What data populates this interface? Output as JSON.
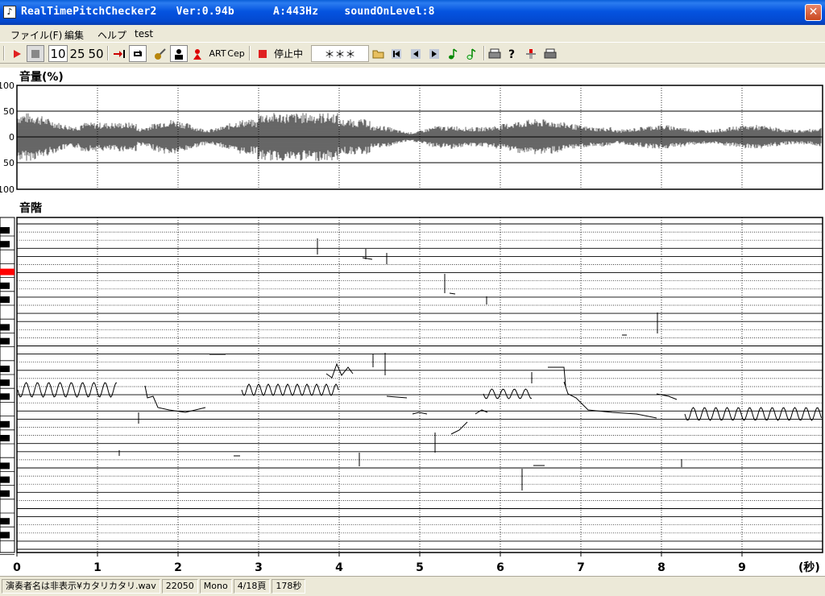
{
  "window": {
    "title": "RealTimePitchChecker2   Ver:0.94b      A:443Hz    soundOnLevel:8",
    "app_icon": "tuning-fork-icon",
    "close_label": "✕"
  },
  "menu": [
    {
      "label": "ファイル(F)"
    },
    {
      "label": "編集"
    },
    {
      "label": "ヘルプ"
    },
    {
      "label": "test"
    }
  ],
  "toolbar": {
    "play_icon": "play-icon",
    "stop_icon": "stop-icon",
    "zoom_10": "10",
    "zoom_25": "25",
    "zoom_50": "50",
    "art_label": "ART",
    "cep_label": "Cep",
    "state_label": "停止中",
    "note_display": "＊＊＊"
  },
  "volume_panel": {
    "label": "音量(%)",
    "y_ticks": [
      "100",
      "50",
      "0",
      "50",
      "100"
    ]
  },
  "pitch_panel": {
    "label": "音階",
    "x_ticks": [
      "0",
      "1",
      "2",
      "3",
      "4",
      "5",
      "6",
      "7",
      "8",
      "9"
    ],
    "x_unit": "(秒)"
  },
  "status": {
    "file": "演奏者名は非表示¥カタリカタリ.wav",
    "sample_rate": "22050",
    "channels": "Mono",
    "page": "4/18頁",
    "duration": "178秒"
  },
  "colors": {
    "titlebar": "#0554e0",
    "highlight_key": "#ff0000",
    "record_red": "#e02020"
  }
}
